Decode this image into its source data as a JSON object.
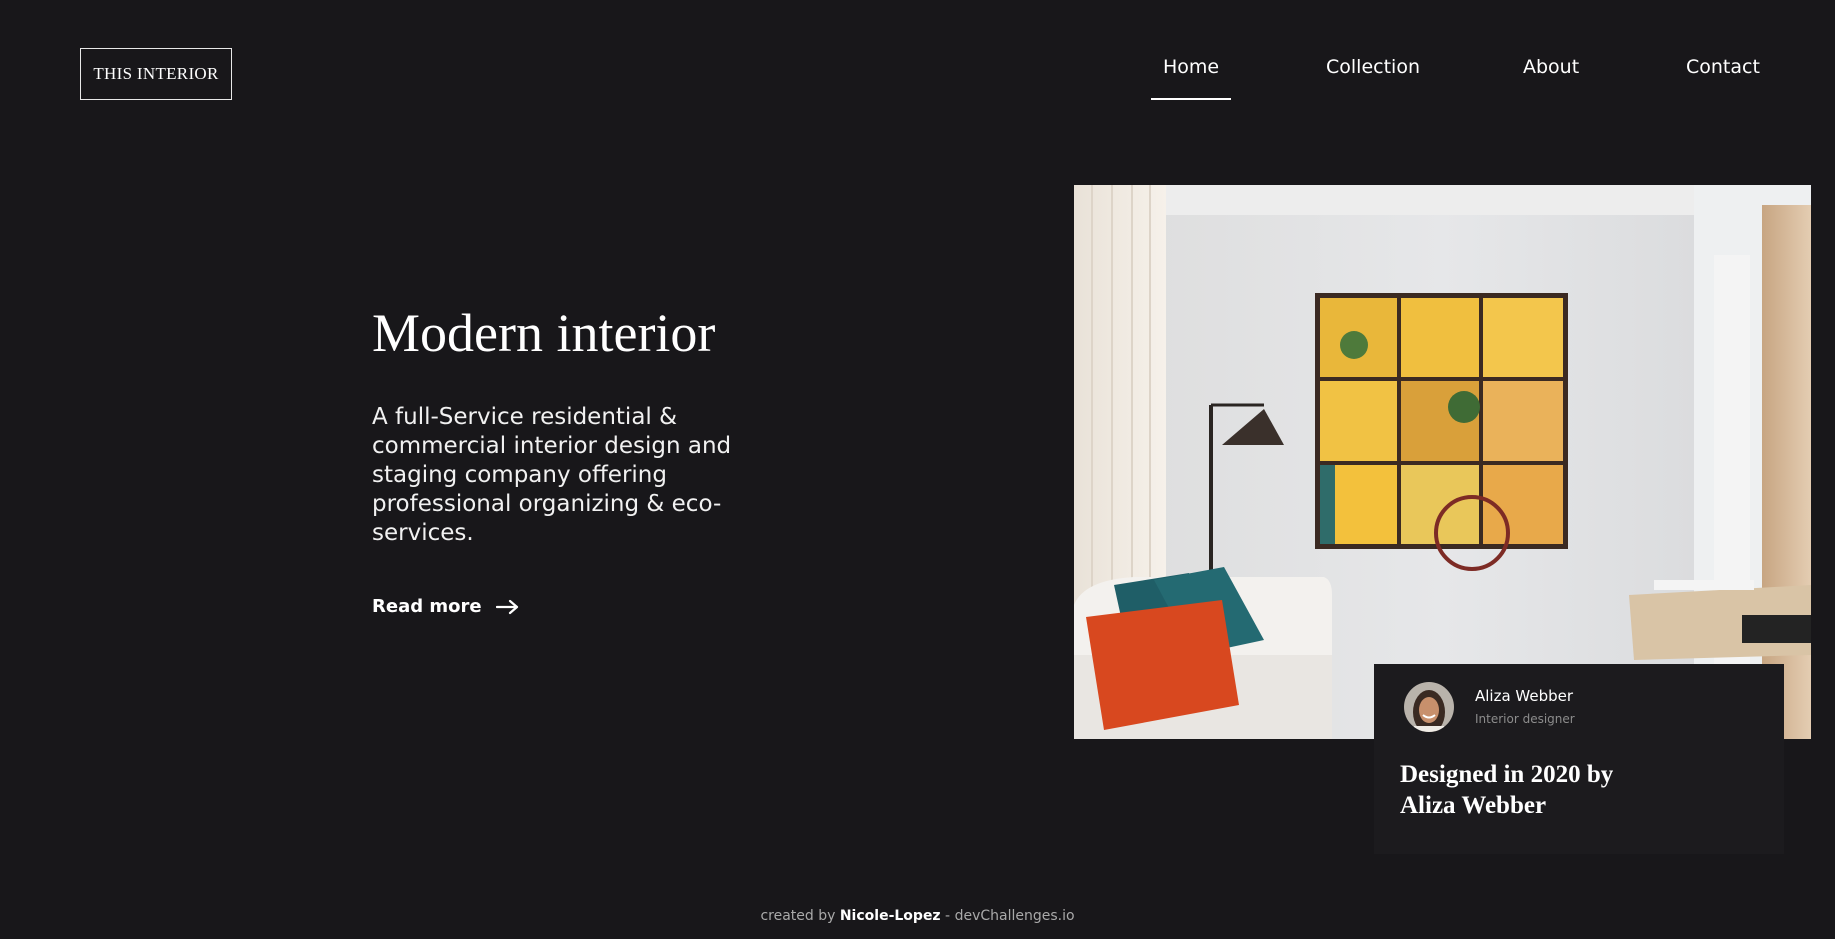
{
  "header": {
    "logo_text": "THIS INTERIOR",
    "nav": [
      {
        "label": "Home",
        "active": true
      },
      {
        "label": "Collection",
        "active": false
      },
      {
        "label": "About",
        "active": false
      },
      {
        "label": "Contact",
        "active": false
      }
    ]
  },
  "hero": {
    "title": "Modern interior",
    "description": "A full-Service residential & commercial interior design and staging company offering professional organizing & eco-services.",
    "cta_label": "Read more",
    "cta_icon": "arrow-right-icon"
  },
  "card": {
    "name": "Aliza Webber",
    "role": "Interior designer",
    "caption": "Designed in 2020 by Aliza Webber"
  },
  "footer": {
    "prefix": "created by",
    "author": "Nicole-Lopez",
    "separator": "-",
    "site": "devChallenges.io"
  },
  "colors": {
    "background": "#18171a",
    "card": "#1c1b1e",
    "text": "#ffffff",
    "muted": "#8c8c8c"
  }
}
